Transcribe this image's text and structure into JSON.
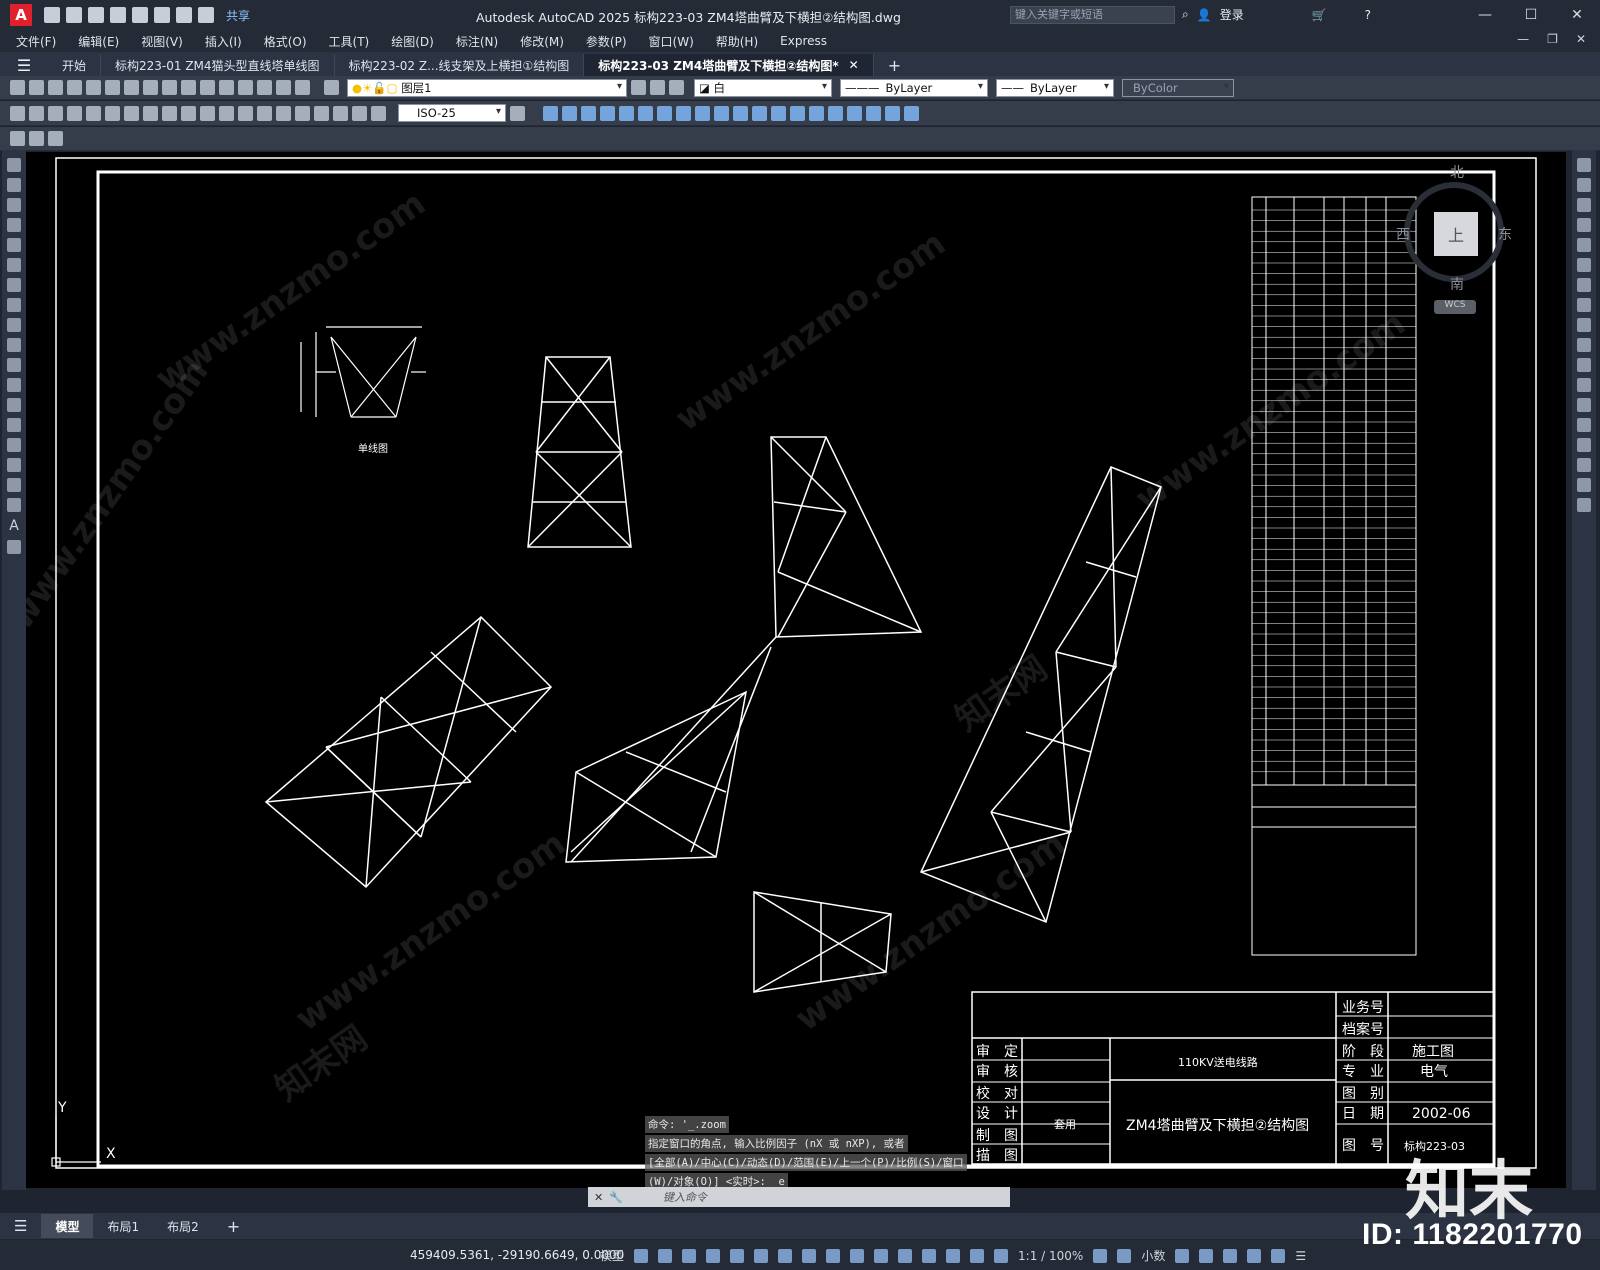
{
  "app": {
    "logo": "A",
    "share_label": "共享",
    "window_title": "Autodesk AutoCAD 2025    标构223-03 ZM4塔曲臂及下横担②结构图.dwg",
    "search_placeholder": "键入关键字或短语",
    "login_label": "登录"
  },
  "menu": [
    "文件(F)",
    "编辑(E)",
    "视图(V)",
    "插入(I)",
    "格式(O)",
    "工具(T)",
    "绘图(D)",
    "标注(N)",
    "修改(M)",
    "参数(P)",
    "窗口(W)",
    "帮助(H)",
    "Express"
  ],
  "tabs": [
    "开始",
    "标构223-01 ZM4猫头型直线塔单线图",
    "标构223-02 Z...线支架及上横担①结构图",
    "标构223-03 ZM4塔曲臂及下横担②结构图*"
  ],
  "toolbar": {
    "layer": "图层1",
    "color": "白",
    "linetype": "ByLayer",
    "lineweight": "ByLayer",
    "plotstyle": "ByColor",
    "dimstyle": "ISO-25"
  },
  "viewcube": {
    "north": "北",
    "south": "南",
    "east": "东",
    "west": "西",
    "top": "上",
    "wcs": "WCS"
  },
  "ucs": {
    "y": "Y",
    "x": "X"
  },
  "drawing": {
    "single_line_label": "单线图",
    "title_block": {
      "business_no": "业务号",
      "archive_no": "档案号",
      "stage_label": "阶　段",
      "stage_value": "施工图",
      "major_label": "专　业",
      "major_value": "电气",
      "category_label": "图　别",
      "date_label": "日　期",
      "date_value": "2002-06",
      "drawing_no_label": "图　号",
      "drawing_no_value": "标构223-03",
      "approve": "审　定",
      "review": "审　核",
      "check": "校　对",
      "design": "设　计",
      "draw": "制　图",
      "trace": "描　图",
      "reuse": "套用",
      "project": "110KV送电线路",
      "title": "ZM4塔曲臂及下横担②结构图"
    }
  },
  "command": {
    "line1": "命令: '_.zoom",
    "line2": "指定窗口的角点, 输入比例因子 (nX 或 nXP), 或者",
    "line3": "[全部(A)/中心(C)/动态(D)/范围(E)/上一个(P)/比例(S)/窗口",
    "line4": "(W)/对象(O)] <实时>: _e",
    "placeholder": "键入命令"
  },
  "layouts": [
    "模型",
    "布局1",
    "布局2"
  ],
  "status": {
    "coords": "459409.5361, -29190.6649, 0.0000",
    "mode": "模型",
    "scale": "1:1 / 100%",
    "units": "小数"
  },
  "watermark": {
    "site": "www.znzmo.com",
    "cn": "知末网",
    "brand": "知末",
    "id": "ID: 1182201770"
  }
}
